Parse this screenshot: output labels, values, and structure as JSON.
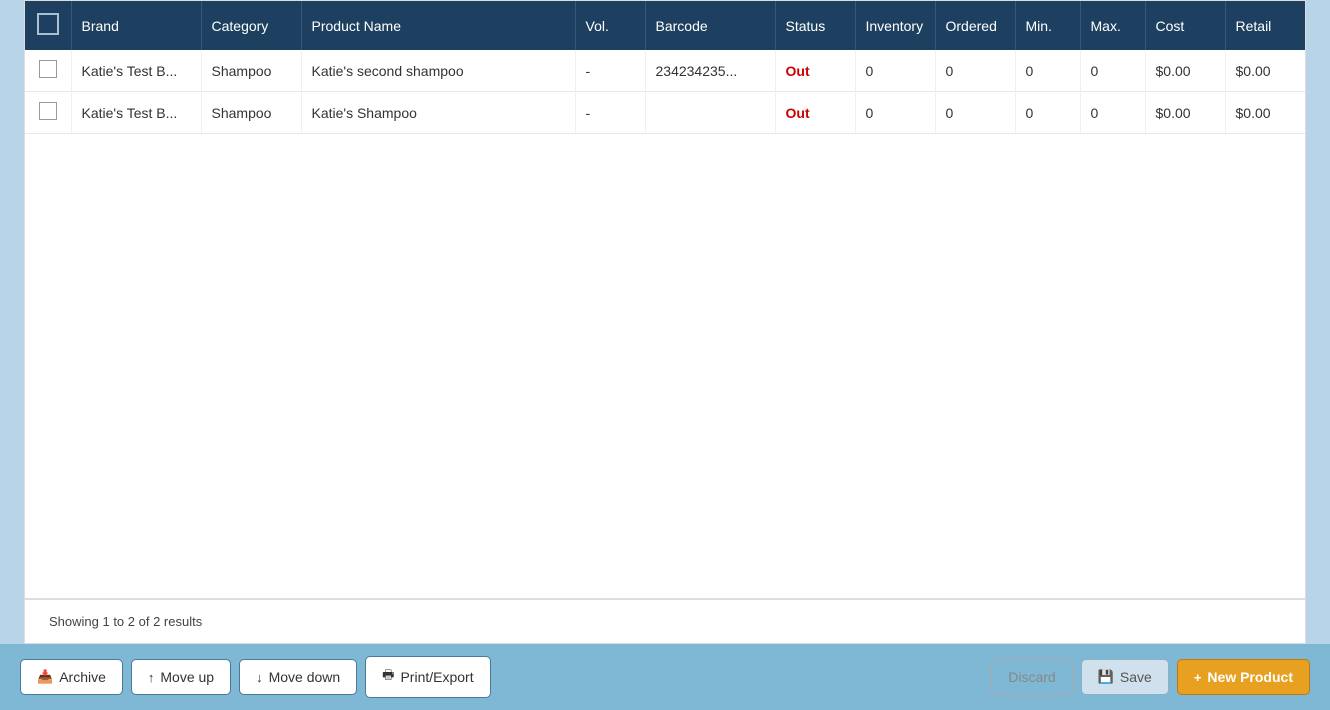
{
  "header": {
    "checkbox_label": ""
  },
  "columns": [
    {
      "key": "checkbox",
      "label": ""
    },
    {
      "key": "brand",
      "label": "Brand"
    },
    {
      "key": "category",
      "label": "Category"
    },
    {
      "key": "product_name",
      "label": "Product Name"
    },
    {
      "key": "vol",
      "label": "Vol."
    },
    {
      "key": "barcode",
      "label": "Barcode"
    },
    {
      "key": "status",
      "label": "Status"
    },
    {
      "key": "inventory",
      "label": "Inventory"
    },
    {
      "key": "ordered",
      "label": "Ordered"
    },
    {
      "key": "min",
      "label": "Min."
    },
    {
      "key": "max",
      "label": "Max."
    },
    {
      "key": "cost",
      "label": "Cost"
    },
    {
      "key": "retail",
      "label": "Retail"
    }
  ],
  "rows": [
    {
      "brand": "Katie's Test B...",
      "category": "Shampoo",
      "product_name": "Katie's second shampoo",
      "vol": "-",
      "barcode": "234234235...",
      "status": "Out",
      "inventory": "0",
      "ordered": "0",
      "min": "0",
      "max": "0",
      "cost": "$0.00",
      "retail": "$0.00"
    },
    {
      "brand": "Katie's Test B...",
      "category": "Shampoo",
      "product_name": "Katie's Shampoo",
      "vol": "-",
      "barcode": "",
      "status": "Out",
      "inventory": "0",
      "ordered": "0",
      "min": "0",
      "max": "0",
      "cost": "$0.00",
      "retail": "$0.00"
    }
  ],
  "footer": {
    "showing_text": "Showing 1 to 2 of 2 results"
  },
  "toolbar": {
    "archive_label": "Archive",
    "move_up_label": "Move up",
    "move_down_label": "Move down",
    "print_export_label": "Print/Export",
    "discard_label": "Discard",
    "save_label": "Save",
    "new_product_label": "New Product"
  }
}
